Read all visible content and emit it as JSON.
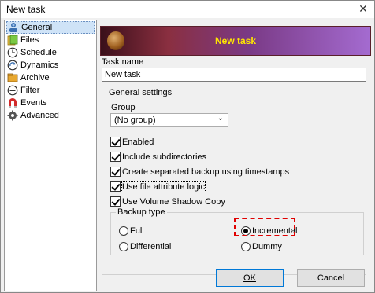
{
  "window": {
    "title": "New task",
    "close_glyph": "✕"
  },
  "sidebar": {
    "items": [
      {
        "label": "General",
        "icon": "general-icon",
        "selected": true
      },
      {
        "label": "Files",
        "icon": "files-icon",
        "selected": false
      },
      {
        "label": "Schedule",
        "icon": "schedule-icon",
        "selected": false
      },
      {
        "label": "Dynamics",
        "icon": "dynamics-icon",
        "selected": false
      },
      {
        "label": "Archive",
        "icon": "archive-icon",
        "selected": false
      },
      {
        "label": "Filter",
        "icon": "filter-icon",
        "selected": false
      },
      {
        "label": "Events",
        "icon": "events-icon",
        "selected": false
      },
      {
        "label": "Advanced",
        "icon": "advanced-icon",
        "selected": false
      }
    ]
  },
  "banner": {
    "title": "New task"
  },
  "task_name": {
    "label": "Task name",
    "value": "New task"
  },
  "general_settings": {
    "legend": "General settings",
    "group": {
      "label": "Group",
      "selected": "(No group)",
      "chevron": "⌄"
    },
    "checkboxes": [
      {
        "label": "Enabled",
        "checked": true
      },
      {
        "label": "Include subdirectories",
        "checked": true
      },
      {
        "label": "Create separated backup using timestamps",
        "checked": true
      },
      {
        "label": "Use file attribute logic",
        "checked": true
      },
      {
        "label": "Use Volume Shadow Copy",
        "checked": true
      }
    ],
    "backup_type": {
      "legend": "Backup type",
      "options": [
        {
          "label": "Full",
          "checked": false
        },
        {
          "label": "Incremental",
          "checked": true
        },
        {
          "label": "Differential",
          "checked": false
        },
        {
          "label": "Dummy",
          "checked": false
        }
      ]
    }
  },
  "buttons": {
    "ok": {
      "label": "OK"
    },
    "cancel": {
      "label": "Cancel"
    }
  },
  "colors": {
    "banner_title": "#ffe600",
    "highlight": "#e00000",
    "selection": "#cfe3f7"
  }
}
